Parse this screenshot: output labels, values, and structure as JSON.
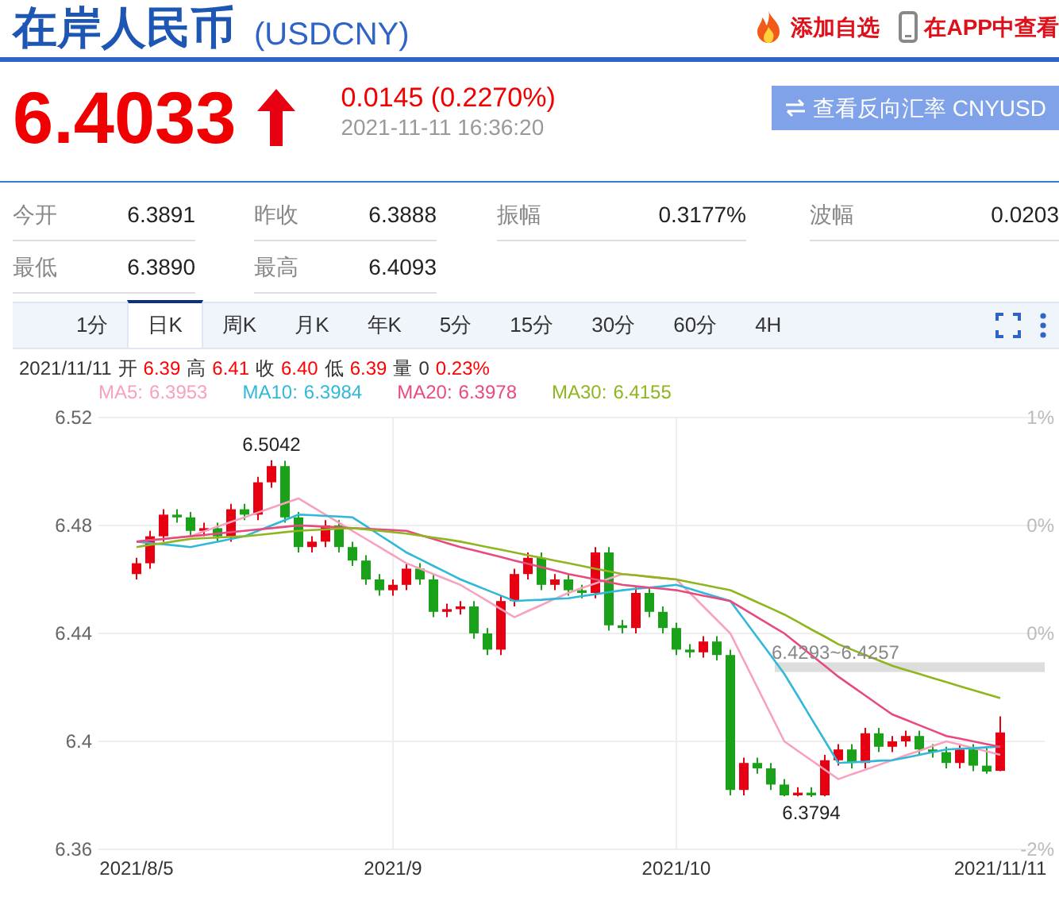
{
  "title": "在岸人民币",
  "code": "(USDCNY)",
  "actions": [
    {
      "kind": "watch",
      "label": "添加自选"
    },
    {
      "kind": "app",
      "label": "在APP中查看"
    }
  ],
  "price": "6.4033",
  "change": "0.0145 (0.2270%)",
  "time": "2021-11-11 16:36:20",
  "reverse_button": "查看反向汇率 CNYUSD",
  "stats": [
    {
      "label": "今开",
      "value": "6.3891"
    },
    {
      "label": "昨收",
      "value": "6.3888"
    },
    {
      "label": "振幅",
      "value": "0.3177%"
    },
    {
      "label": "波幅",
      "value": "0.0203"
    },
    {
      "label": "最低",
      "value": "6.3890"
    },
    {
      "label": "最高",
      "value": "6.4093"
    }
  ],
  "tabs": [
    {
      "label": "1分",
      "selected": false
    },
    {
      "label": "日K",
      "selected": true
    },
    {
      "label": "周K",
      "selected": false
    },
    {
      "label": "月K",
      "selected": false
    },
    {
      "label": "年K",
      "selected": false
    },
    {
      "label": "5分",
      "selected": false
    },
    {
      "label": "15分",
      "selected": false
    },
    {
      "label": "30分",
      "selected": false
    },
    {
      "label": "60分",
      "selected": false
    },
    {
      "label": "4H",
      "selected": false
    }
  ],
  "info": {
    "date": "2021/11/11",
    "fields": [
      {
        "label": "开",
        "value": "6.39"
      },
      {
        "label": "高",
        "value": "6.41"
      },
      {
        "label": "收",
        "value": "6.40"
      },
      {
        "label": "低",
        "value": "6.39"
      },
      {
        "label": "量",
        "value": "0"
      }
    ],
    "pct": "0.23%"
  },
  "chart": {
    "range_label": "6.4293~6.4257",
    "right_labels": [
      "1%",
      "0%",
      "0%",
      "-2%"
    ],
    "high_label": "6.5042",
    "low_label": "6.3794",
    "ma_values": [
      "6.3953",
      "6.3984",
      "6.3978",
      "6.4155"
    ],
    "chart_data": {
      "type": "candlestick",
      "grid": true,
      "ylim": [
        6.36,
        6.52
      ],
      "yticks": [
        6.52,
        6.48,
        6.44,
        6.4,
        6.36
      ],
      "categories": [
        "2021/8/5",
        null,
        null,
        null,
        null,
        null,
        null,
        null,
        null,
        null,
        null,
        null,
        null,
        null,
        null,
        null,
        null,
        null,
        null,
        "2021/9",
        null,
        null,
        null,
        null,
        null,
        null,
        null,
        null,
        null,
        null,
        null,
        null,
        null,
        null,
        null,
        null,
        null,
        null,
        null,
        null,
        "2021/10",
        null,
        null,
        null,
        null,
        null,
        null,
        null,
        null,
        null,
        null,
        null,
        null,
        null,
        null,
        null,
        null,
        null,
        null,
        null,
        null,
        null,
        null,
        null,
        "2021/11/11"
      ],
      "ohlc": [
        [
          6.462,
          6.468,
          6.46,
          6.466
        ],
        [
          6.466,
          6.478,
          6.464,
          6.476
        ],
        [
          6.476,
          6.486,
          6.474,
          6.484
        ],
        [
          6.484,
          6.486,
          6.481,
          6.483
        ],
        [
          6.483,
          6.485,
          6.476,
          6.478
        ],
        [
          6.478,
          6.481,
          6.476,
          6.479
        ],
        [
          6.479,
          6.481,
          6.474,
          6.476
        ],
        [
          6.476,
          6.488,
          6.474,
          6.486
        ],
        [
          6.486,
          6.488,
          6.482,
          6.484
        ],
        [
          6.484,
          6.498,
          6.482,
          6.496
        ],
        [
          6.496,
          6.5042,
          6.494,
          6.502
        ],
        [
          6.502,
          6.504,
          6.481,
          6.483
        ],
        [
          6.483,
          6.485,
          6.47,
          6.472
        ],
        [
          6.472,
          6.476,
          6.47,
          6.474
        ],
        [
          6.474,
          6.482,
          6.472,
          6.48
        ],
        [
          6.48,
          6.482,
          6.47,
          6.472
        ],
        [
          6.472,
          6.474,
          6.465,
          6.467
        ],
        [
          6.467,
          6.469,
          6.458,
          6.46
        ],
        [
          6.46,
          6.462,
          6.454,
          6.456
        ],
        [
          6.456,
          6.46,
          6.454,
          6.458
        ],
        [
          6.458,
          6.466,
          6.456,
          6.464
        ],
        [
          6.464,
          6.466,
          6.458,
          6.46
        ],
        [
          6.46,
          6.462,
          6.446,
          6.448
        ],
        [
          6.448,
          6.451,
          6.446,
          6.449
        ],
        [
          6.449,
          6.452,
          6.447,
          6.45
        ],
        [
          6.45,
          6.452,
          6.438,
          6.44
        ],
        [
          6.44,
          6.442,
          6.432,
          6.434
        ],
        [
          6.434,
          6.454,
          6.432,
          6.452
        ],
        [
          6.452,
          6.464,
          6.45,
          6.462
        ],
        [
          6.462,
          6.47,
          6.46,
          6.468
        ],
        [
          6.468,
          6.47,
          6.456,
          6.458
        ],
        [
          6.458,
          6.462,
          6.456,
          6.46
        ],
        [
          6.46,
          6.462,
          6.454,
          6.456
        ],
        [
          6.456,
          6.458,
          6.453,
          6.455
        ],
        [
          6.455,
          6.472,
          6.453,
          6.47
        ],
        [
          6.47,
          6.472,
          6.441,
          6.443
        ],
        [
          6.443,
          6.445,
          6.44,
          6.442
        ],
        [
          6.442,
          6.457,
          6.44,
          6.455
        ],
        [
          6.455,
          6.457,
          6.446,
          6.448
        ],
        [
          6.448,
          6.45,
          6.44,
          6.442
        ],
        [
          6.442,
          6.444,
          6.432,
          6.434
        ],
        [
          6.434,
          6.436,
          6.431,
          6.433
        ],
        [
          6.433,
          6.439,
          6.431,
          6.437
        ],
        [
          6.437,
          6.439,
          6.43,
          6.432
        ],
        [
          6.432,
          6.434,
          6.38,
          6.382
        ],
        [
          6.382,
          6.394,
          6.38,
          6.392
        ],
        [
          6.392,
          6.394,
          6.388,
          6.39
        ],
        [
          6.39,
          6.392,
          6.382,
          6.384
        ],
        [
          6.384,
          6.386,
          6.3796,
          6.38
        ],
        [
          6.38,
          6.383,
          6.3796,
          6.381
        ],
        [
          6.381,
          6.383,
          6.3794,
          6.38
        ],
        [
          6.38,
          6.395,
          6.3796,
          6.393
        ],
        [
          6.393,
          6.399,
          6.391,
          6.397
        ],
        [
          6.397,
          6.399,
          6.39,
          6.392
        ],
        [
          6.392,
          6.405,
          6.39,
          6.403
        ],
        [
          6.403,
          6.405,
          6.396,
          6.398
        ],
        [
          6.398,
          6.402,
          6.396,
          6.4
        ],
        [
          6.4,
          6.404,
          6.398,
          6.402
        ],
        [
          6.402,
          6.404,
          6.395,
          6.397
        ],
        [
          6.397,
          6.399,
          6.394,
          6.396
        ],
        [
          6.396,
          6.398,
          6.39,
          6.392
        ],
        [
          6.392,
          6.399,
          6.39,
          6.397
        ],
        [
          6.397,
          6.399,
          6.389,
          6.391
        ],
        [
          6.391,
          6.398,
          6.388,
          6.3888
        ],
        [
          6.3891,
          6.4093,
          6.389,
          6.4033
        ]
      ],
      "series": [
        {
          "name": "MA5:",
          "type": "line",
          "color": "#f7a1be",
          "values": [
            6.474,
            6.4745,
            6.475,
            6.4755,
            6.476,
            6.4778,
            6.4795,
            6.4813,
            6.483,
            6.4848,
            6.4865,
            6.4883,
            6.49,
            6.487,
            6.484,
            6.481,
            6.478,
            6.475,
            6.472,
            6.469,
            6.466,
            6.464,
            6.462,
            6.46,
            6.458,
            6.455,
            6.452,
            6.449,
            6.446,
            6.4483,
            6.4505,
            6.4528,
            6.455,
            6.4568,
            6.4585,
            6.4603,
            6.462,
            6.4615,
            6.461,
            6.4605,
            6.46,
            6.455,
            6.45,
            6.445,
            6.44,
            6.43,
            6.42,
            6.41,
            6.4,
            6.3965,
            6.393,
            6.3895,
            6.386,
            6.3878,
            6.3895,
            6.3913,
            6.393,
            6.3948,
            6.3965,
            6.3983,
            6.4,
            6.3988,
            6.3975,
            6.3963,
            6.395
          ]
        },
        {
          "name": "MA10:",
          "type": "line",
          "color": "#31b8d9",
          "values": [
            6.474,
            6.4735,
            6.473,
            6.4725,
            6.472,
            6.473,
            6.474,
            6.475,
            6.476,
            6.478,
            6.48,
            6.482,
            6.484,
            6.4838,
            6.4835,
            6.4833,
            6.483,
            6.4798,
            6.4765,
            6.4733,
            6.47,
            6.4675,
            6.465,
            6.4625,
            6.46,
            6.458,
            6.456,
            6.454,
            6.452,
            6.4523,
            6.4525,
            6.4528,
            6.453,
            6.4538,
            6.4545,
            6.4553,
            6.456,
            6.4565,
            6.457,
            6.4575,
            6.458,
            6.4565,
            6.455,
            6.4535,
            6.452,
            6.4453,
            6.4385,
            6.4318,
            6.425,
            6.4168,
            6.4085,
            6.4003,
            6.392,
            6.3923,
            6.3925,
            6.3928,
            6.393,
            6.394,
            6.395,
            6.396,
            6.397,
            6.3973,
            6.3975,
            6.3978,
            6.398
          ]
        },
        {
          "name": "MA20:",
          "type": "line",
          "color": "#e84a7f",
          "values": [
            6.474,
            6.4745,
            6.475,
            6.4755,
            6.476,
            6.4765,
            6.477,
            6.4775,
            6.478,
            6.4785,
            6.479,
            6.4795,
            6.48,
            6.4798,
            6.4795,
            6.4793,
            6.479,
            6.4788,
            6.4785,
            6.4783,
            6.478,
            6.4765,
            6.475,
            6.4735,
            6.472,
            6.4708,
            6.4695,
            6.4683,
            6.467,
            6.4658,
            6.4645,
            6.4633,
            6.462,
            6.461,
            6.46,
            6.459,
            6.458,
            6.4575,
            6.457,
            6.4565,
            6.456,
            6.455,
            6.454,
            6.453,
            6.452,
            6.449,
            6.446,
            6.443,
            6.44,
            6.436,
            6.432,
            6.428,
            6.424,
            6.4205,
            6.417,
            6.4135,
            6.41,
            6.408,
            6.406,
            6.404,
            6.402,
            6.401,
            6.4,
            6.399,
            6.398
          ]
        },
        {
          "name": "MA30:",
          "type": "line",
          "color": "#8fb51f",
          "values": [
            6.472,
            6.4728,
            6.4735,
            6.4743,
            6.475,
            6.4753,
            6.4755,
            6.4758,
            6.476,
            6.4765,
            6.477,
            6.4775,
            6.478,
            6.4783,
            6.4785,
            6.4788,
            6.479,
            6.4785,
            6.478,
            6.4775,
            6.477,
            6.4763,
            6.4755,
            6.4748,
            6.474,
            6.473,
            6.472,
            6.471,
            6.47,
            6.469,
            6.468,
            6.467,
            6.466,
            6.465,
            6.464,
            6.463,
            6.462,
            6.4615,
            6.461,
            6.4605,
            6.46,
            6.459,
            6.458,
            6.457,
            6.456,
            6.4538,
            6.4515,
            6.4493,
            6.447,
            6.4443,
            6.4415,
            6.4388,
            6.436,
            6.434,
            6.432,
            6.43,
            6.428,
            6.4265,
            6.425,
            6.4235,
            6.422,
            6.4205,
            6.419,
            6.4175,
            6.416
          ]
        }
      ]
    }
  }
}
